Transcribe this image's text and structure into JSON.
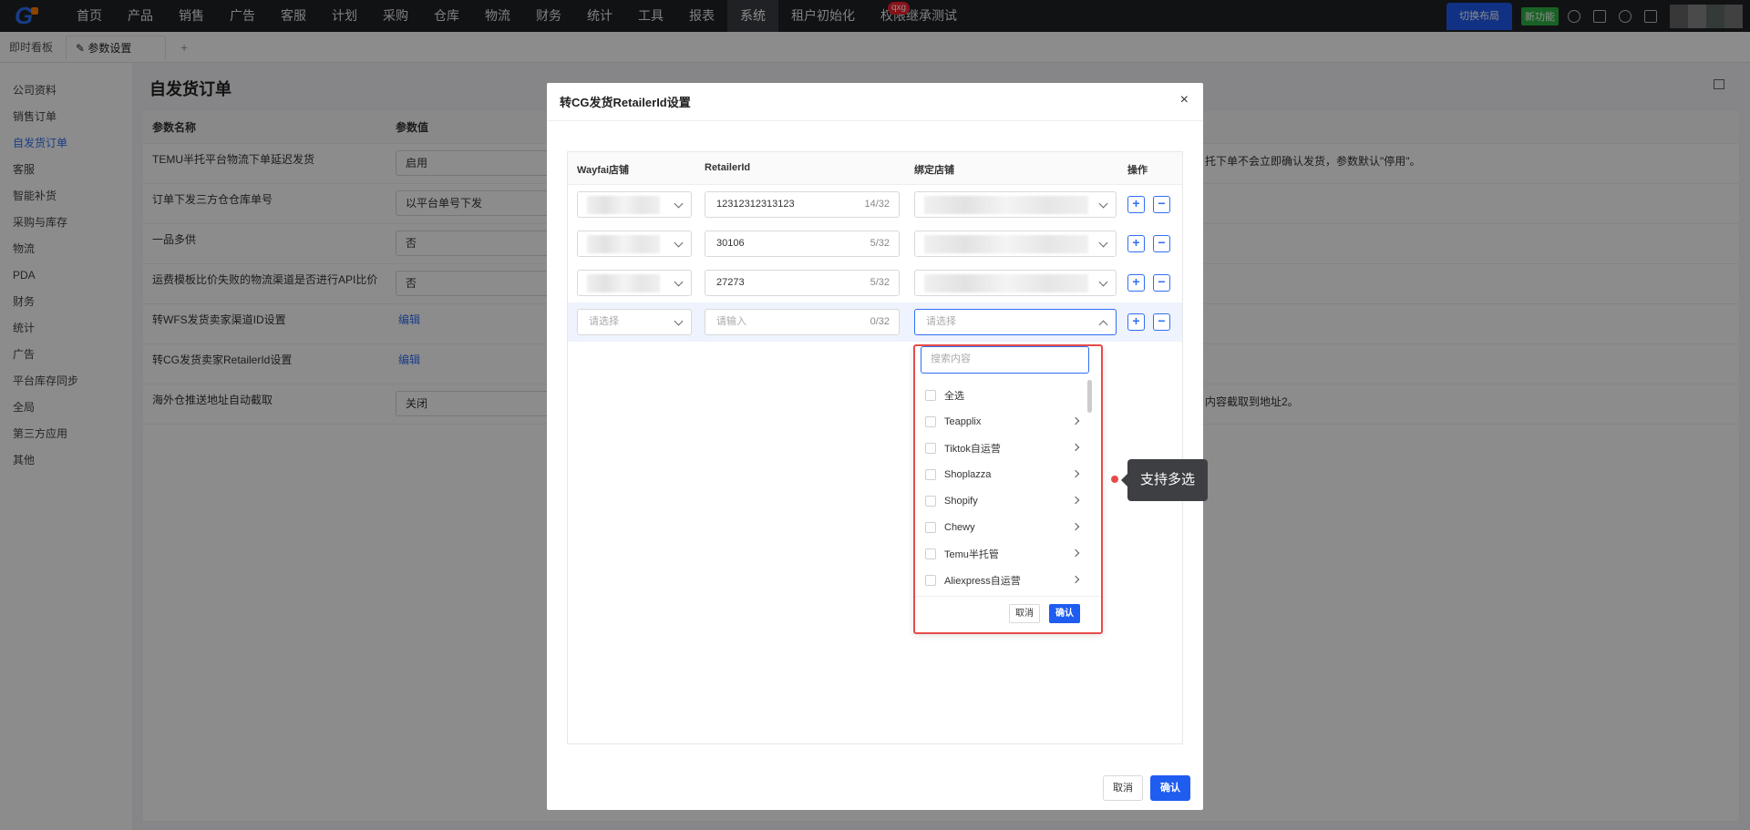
{
  "topnav": {
    "items": [
      "首页",
      "产品",
      "销售",
      "广告",
      "客服",
      "计划",
      "采购",
      "仓库",
      "物流",
      "财务",
      "统计",
      "工具",
      "报表",
      "系统",
      "租户初始化",
      "权限继承测试"
    ],
    "active_index": 13,
    "badge": "qxg",
    "switch_layout": "切换布局",
    "new_feature": "新功能"
  },
  "tabs": {
    "dashboard": "即时看板",
    "current": "参数设置",
    "add": "+"
  },
  "sidebar": {
    "items": [
      "公司资料",
      "销售订单",
      "自发货订单",
      "客服",
      "智能补货",
      "采购与库存",
      "物流",
      "PDA",
      "财务",
      "统计",
      "广告",
      "平台库存同步",
      "全局",
      "第三方应用",
      "其他"
    ],
    "active_index": 2
  },
  "main": {
    "title": "自发货订单",
    "col_name": "参数名称",
    "col_value": "参数值",
    "rows": [
      {
        "name": "TEMU半托平台物流下单延迟发货",
        "value": "启用",
        "desc": "托下单不会立即确认发货，参数默认\"停用\"。"
      },
      {
        "name": "订单下发三方仓仓库单号",
        "value": "以平台单号下发"
      },
      {
        "name": "一品多供",
        "value": "否"
      },
      {
        "name": "运费模板比价失败的物流渠道是否进行API比价",
        "value": "否"
      },
      {
        "name": "转WFS发货卖家渠道ID设置",
        "link": "编辑"
      },
      {
        "name": "转CG发货卖家RetailerId设置",
        "link": "编辑"
      },
      {
        "name": "海外仓推送地址自动截取",
        "value": "关闭",
        "desc": "内容截取到地址2。"
      }
    ]
  },
  "modal": {
    "title": "转CG发货RetailerId设置",
    "close": "×",
    "headers": {
      "wayfair": "Wayfai店铺",
      "retailer": "RetailerId",
      "bind": "绑定店铺",
      "ops": "操作"
    },
    "rows": [
      {
        "retailer_value": "12312312313123",
        "count": "14/32"
      },
      {
        "retailer_value": "30106",
        "count": "5/32"
      },
      {
        "retailer_value": "27273",
        "count": "5/32"
      }
    ],
    "new_row": {
      "wayfair_placeholder": "请选择",
      "retailer_placeholder": "请输入",
      "count": "0/32",
      "bind_placeholder": "请选择"
    },
    "plus": "+",
    "minus": "−",
    "cancel": "取消",
    "confirm": "确认"
  },
  "dropdown": {
    "search_placeholder": "搜索内容",
    "options": [
      "全选",
      "Teapplix",
      "Tiktok自运营",
      "Shoplazza",
      "Shopify",
      "Chewy",
      "Temu半托管",
      "Aliexpress自运营"
    ],
    "cancel": "取消",
    "confirm": "确认"
  },
  "tooltip": "支持多选",
  "colors": {
    "accent": "#2f6ff5",
    "highlight": "#e84a4a",
    "nav_bg": "#1f2126"
  }
}
